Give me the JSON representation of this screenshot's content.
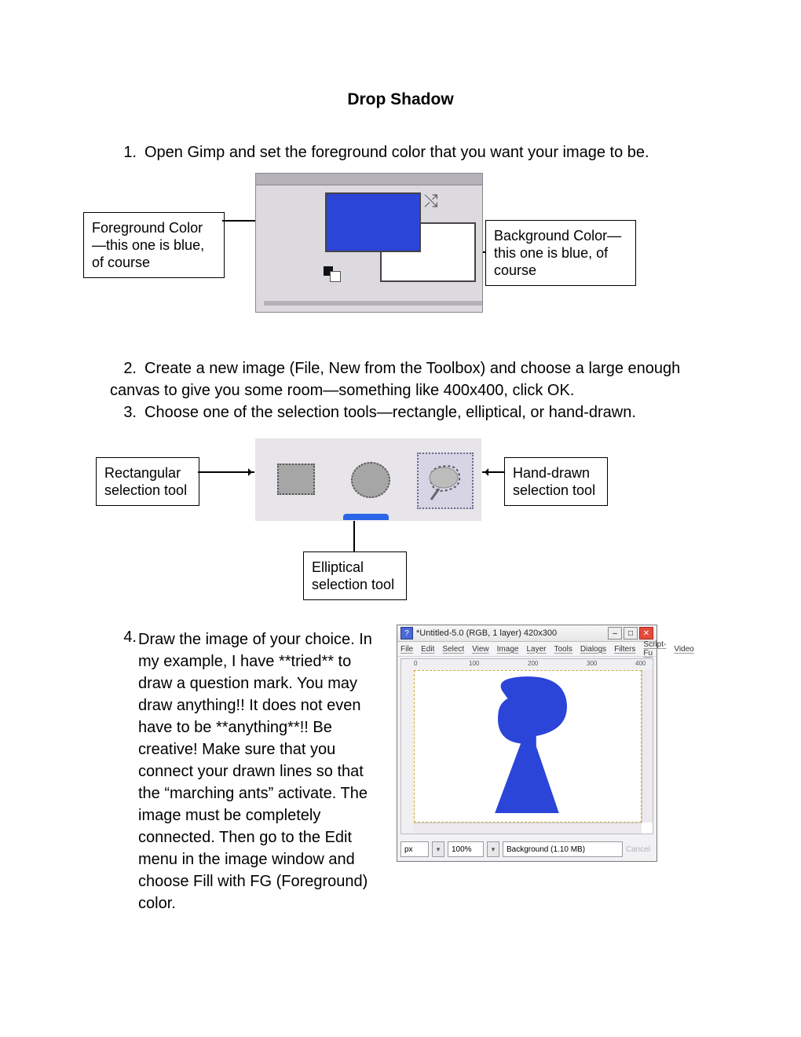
{
  "title": "Drop Shadow",
  "steps": {
    "s1": {
      "num": "1.",
      "text": "Open Gimp and set the foreground color that you want your image to be."
    },
    "s2": {
      "num": "2.",
      "text": "Create a new image (File, New from the Toolbox) and choose a large enough canvas to give you some room—something like 400x400, click OK."
    },
    "s3": {
      "num": "3.",
      "text": "Choose one of the selection tools—rectangle, elliptical, or hand-drawn."
    },
    "s4": {
      "num": "4.",
      "text": "Draw the image of your choice.  In my example, I have **tried** to draw a question mark.  You may draw anything!!  It does not even have to be **anything**!!  Be creative!  Make sure that you connect your drawn lines so that the “marching ants” activate.  The image must be completely connected.  Then go to the Edit menu in the image window and choose Fill with FG (Foreground) color."
    }
  },
  "callouts": {
    "fg": "Foreground Color—this one is blue, of course",
    "bg": "Background Color—this one is blue, of course",
    "rect": "Rectangular selection tool",
    "ell": "Elliptical selection tool",
    "free": "Hand-drawn selection tool"
  },
  "gimp": {
    "title": "*Untitled-5.0 (RGB, 1 layer) 420x300",
    "menus": [
      "File",
      "Edit",
      "Select",
      "View",
      "Image",
      "Layer",
      "Tools",
      "Dialogs",
      "Filters",
      "Script-Fu",
      "Video"
    ],
    "ruler_ticks": [
      "0",
      "100",
      "200",
      "300",
      "400"
    ],
    "unit": "px",
    "zoom": "100%",
    "status": "Background (1.10 MB)",
    "cancel": "Cancel"
  }
}
